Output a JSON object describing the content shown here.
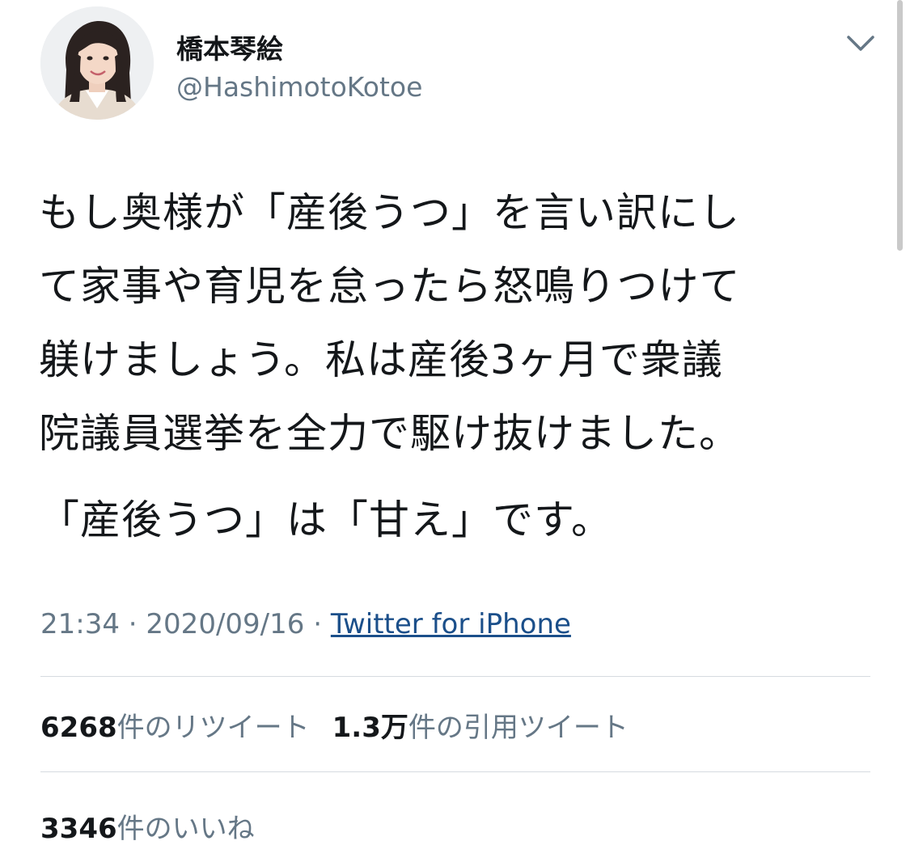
{
  "profile": {
    "display_name": "橋本琴絵",
    "handle": "@HashimotoKotoe",
    "avatar_icon": "profile-photo"
  },
  "menu_icon": "chevron-down-icon",
  "tweet": {
    "lines": [
      "もし奥様が「産後うつ」を言い訳にし",
      "て家事や育児を怠ったら怒鳴りつけて",
      "躾けましょう。私は産後3ヶ月で衆議",
      "院議員選挙を全力で駆け抜けました。"
    ],
    "last_line": "「産後うつ」は「甘え」です。"
  },
  "meta": {
    "time": "21:34",
    "separator": "·",
    "date": "2020/09/16",
    "source": "Twitter for iPhone"
  },
  "stats": {
    "retweets_count": "6268",
    "retweets_label": "件のリツイート",
    "quotes_count": "1.3万",
    "quotes_label": "件の引用ツイート",
    "likes_count": "3346",
    "likes_label": "件のいいね"
  },
  "colors": {
    "text": "#14171a",
    "secondary": "#657786",
    "link": "#1b4f8a",
    "divider": "#d6dbe0"
  }
}
